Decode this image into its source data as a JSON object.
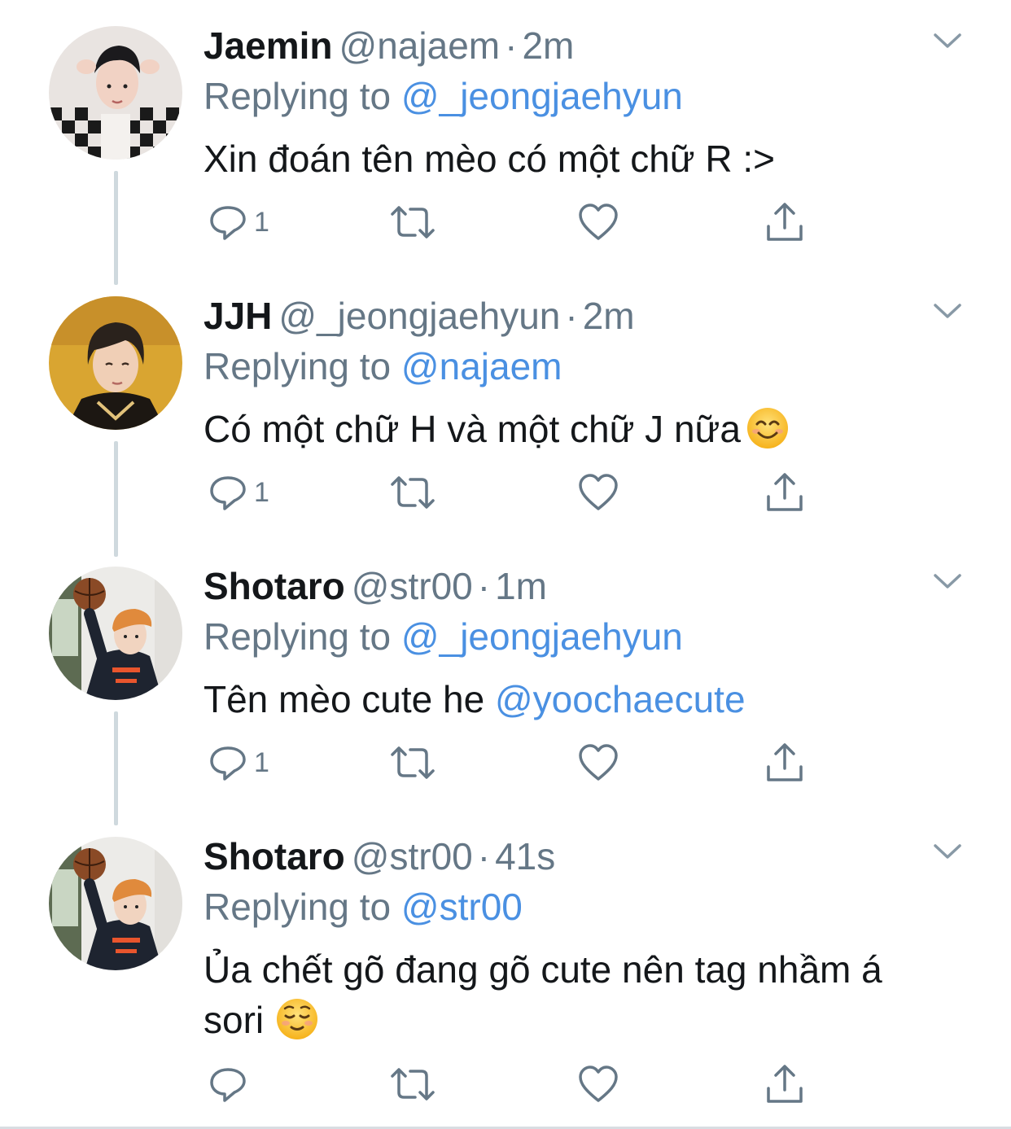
{
  "tweets": [
    {
      "name": "Jaemin",
      "handle": "@najaem",
      "separator": "·",
      "time": "2m",
      "replying_prefix": "Replying to ",
      "replying_to": "@_jeongjaehyun",
      "text": "Xin đoán tên mèo có một chữ R :>",
      "text_mention": "",
      "emoji": "",
      "reply_count": "1"
    },
    {
      "name": "JJH",
      "handle": "@_jeongjaehyun",
      "separator": "·",
      "time": "2m",
      "replying_prefix": "Replying to ",
      "replying_to": "@najaem",
      "text": "Có một chữ H và một chữ J nữa",
      "text_mention": "",
      "emoji": "smiling-face-emoji",
      "reply_count": "1"
    },
    {
      "name": "Shotaro",
      "handle": "@str00",
      "separator": "·",
      "time": "1m",
      "replying_prefix": "Replying to ",
      "replying_to": "@_jeongjaehyun",
      "text": "Tên mèo cute he ",
      "text_mention": "@yoochaecute",
      "emoji": "",
      "reply_count": "1"
    },
    {
      "name": "Shotaro",
      "handle": "@str00",
      "separator": "·",
      "time": "41s",
      "replying_prefix": "Replying to ",
      "replying_to": "@str00",
      "text": "Ủa chết gõ đang gõ cute nên tag nhầm á sori",
      "text_mention": "",
      "emoji": "relieved-face-emoji",
      "reply_count": ""
    }
  ],
  "icons": {
    "reply": "reply-icon",
    "retweet": "retweet-icon",
    "like": "heart-icon",
    "share": "share-icon",
    "more": "chevron-down-icon"
  },
  "colors": {
    "name": "#14171a",
    "secondary": "#657786",
    "mention": "#4a90e2",
    "thread_line": "#cfd9de",
    "icon": "#657786"
  }
}
